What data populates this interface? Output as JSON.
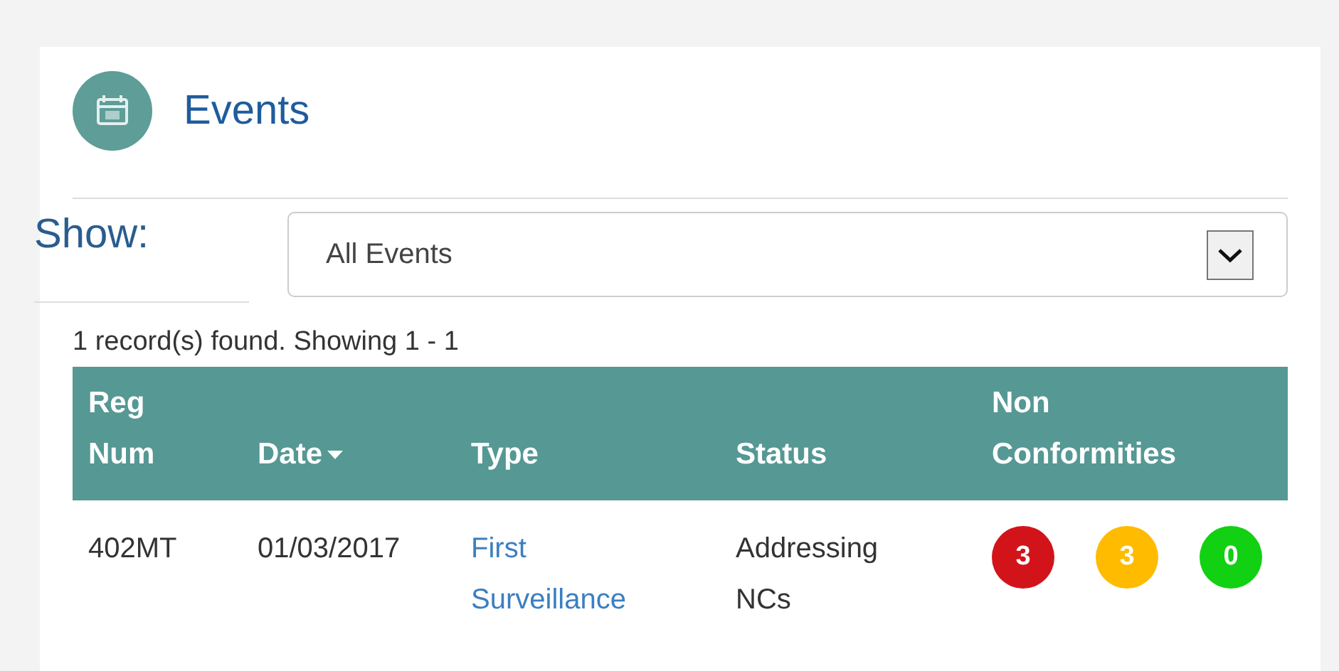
{
  "panel": {
    "title": "Events"
  },
  "filter": {
    "label": "Show:",
    "value": "All Events"
  },
  "record_summary": "1 record(s) found. Showing 1 - 1",
  "table": {
    "columns": [
      {
        "label": "Reg Num",
        "sorted": false
      },
      {
        "label": "Date",
        "sorted": true
      },
      {
        "label": "Type",
        "sorted": false
      },
      {
        "label": "Status",
        "sorted": false
      },
      {
        "label": "Non Conformities",
        "sorted": false
      }
    ],
    "rows": [
      {
        "reg_num": "402MT",
        "date": "01/03/2017",
        "type": "First Surveillance",
        "status": "Addressing NCs",
        "non_conformities": [
          {
            "count": "3",
            "color": "#d2141a"
          },
          {
            "count": "3",
            "color": "#ffbb00"
          },
          {
            "count": "0",
            "color": "#12d012"
          }
        ]
      }
    ]
  }
}
